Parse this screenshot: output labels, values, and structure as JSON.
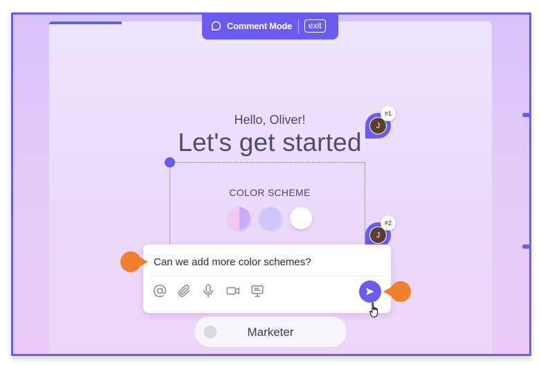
{
  "mode_bar": {
    "label": "Comment Mode",
    "exit_label": "exit",
    "icon": "comment-icon"
  },
  "page": {
    "greeting": "Hello, Oliver!",
    "headline": "Let's get started"
  },
  "color_scheme": {
    "label": "COLOR SCHEME",
    "swatches": [
      {
        "name": "pink-purple",
        "colors": [
          "#f7c7ee",
          "#c7adfa"
        ]
      },
      {
        "name": "lavender",
        "colors": [
          "#cdc7fb"
        ]
      },
      {
        "name": "white",
        "colors": [
          "#ffffff"
        ]
      }
    ]
  },
  "pins": [
    {
      "number": "#1",
      "initial": "J"
    },
    {
      "number": "#2",
      "initial": "J"
    }
  ],
  "comment": {
    "text": "Can we add more color schemes?",
    "tools": [
      "at-sign-icon",
      "paperclip-icon",
      "microphone-icon",
      "video-icon",
      "screen-share-icon"
    ],
    "send_icon": "send-icon"
  },
  "option": {
    "label": "Marketer",
    "selected": false
  },
  "colors": {
    "accent": "#6a5cf2",
    "marker": "#f08030",
    "progress": "#5965e2"
  }
}
